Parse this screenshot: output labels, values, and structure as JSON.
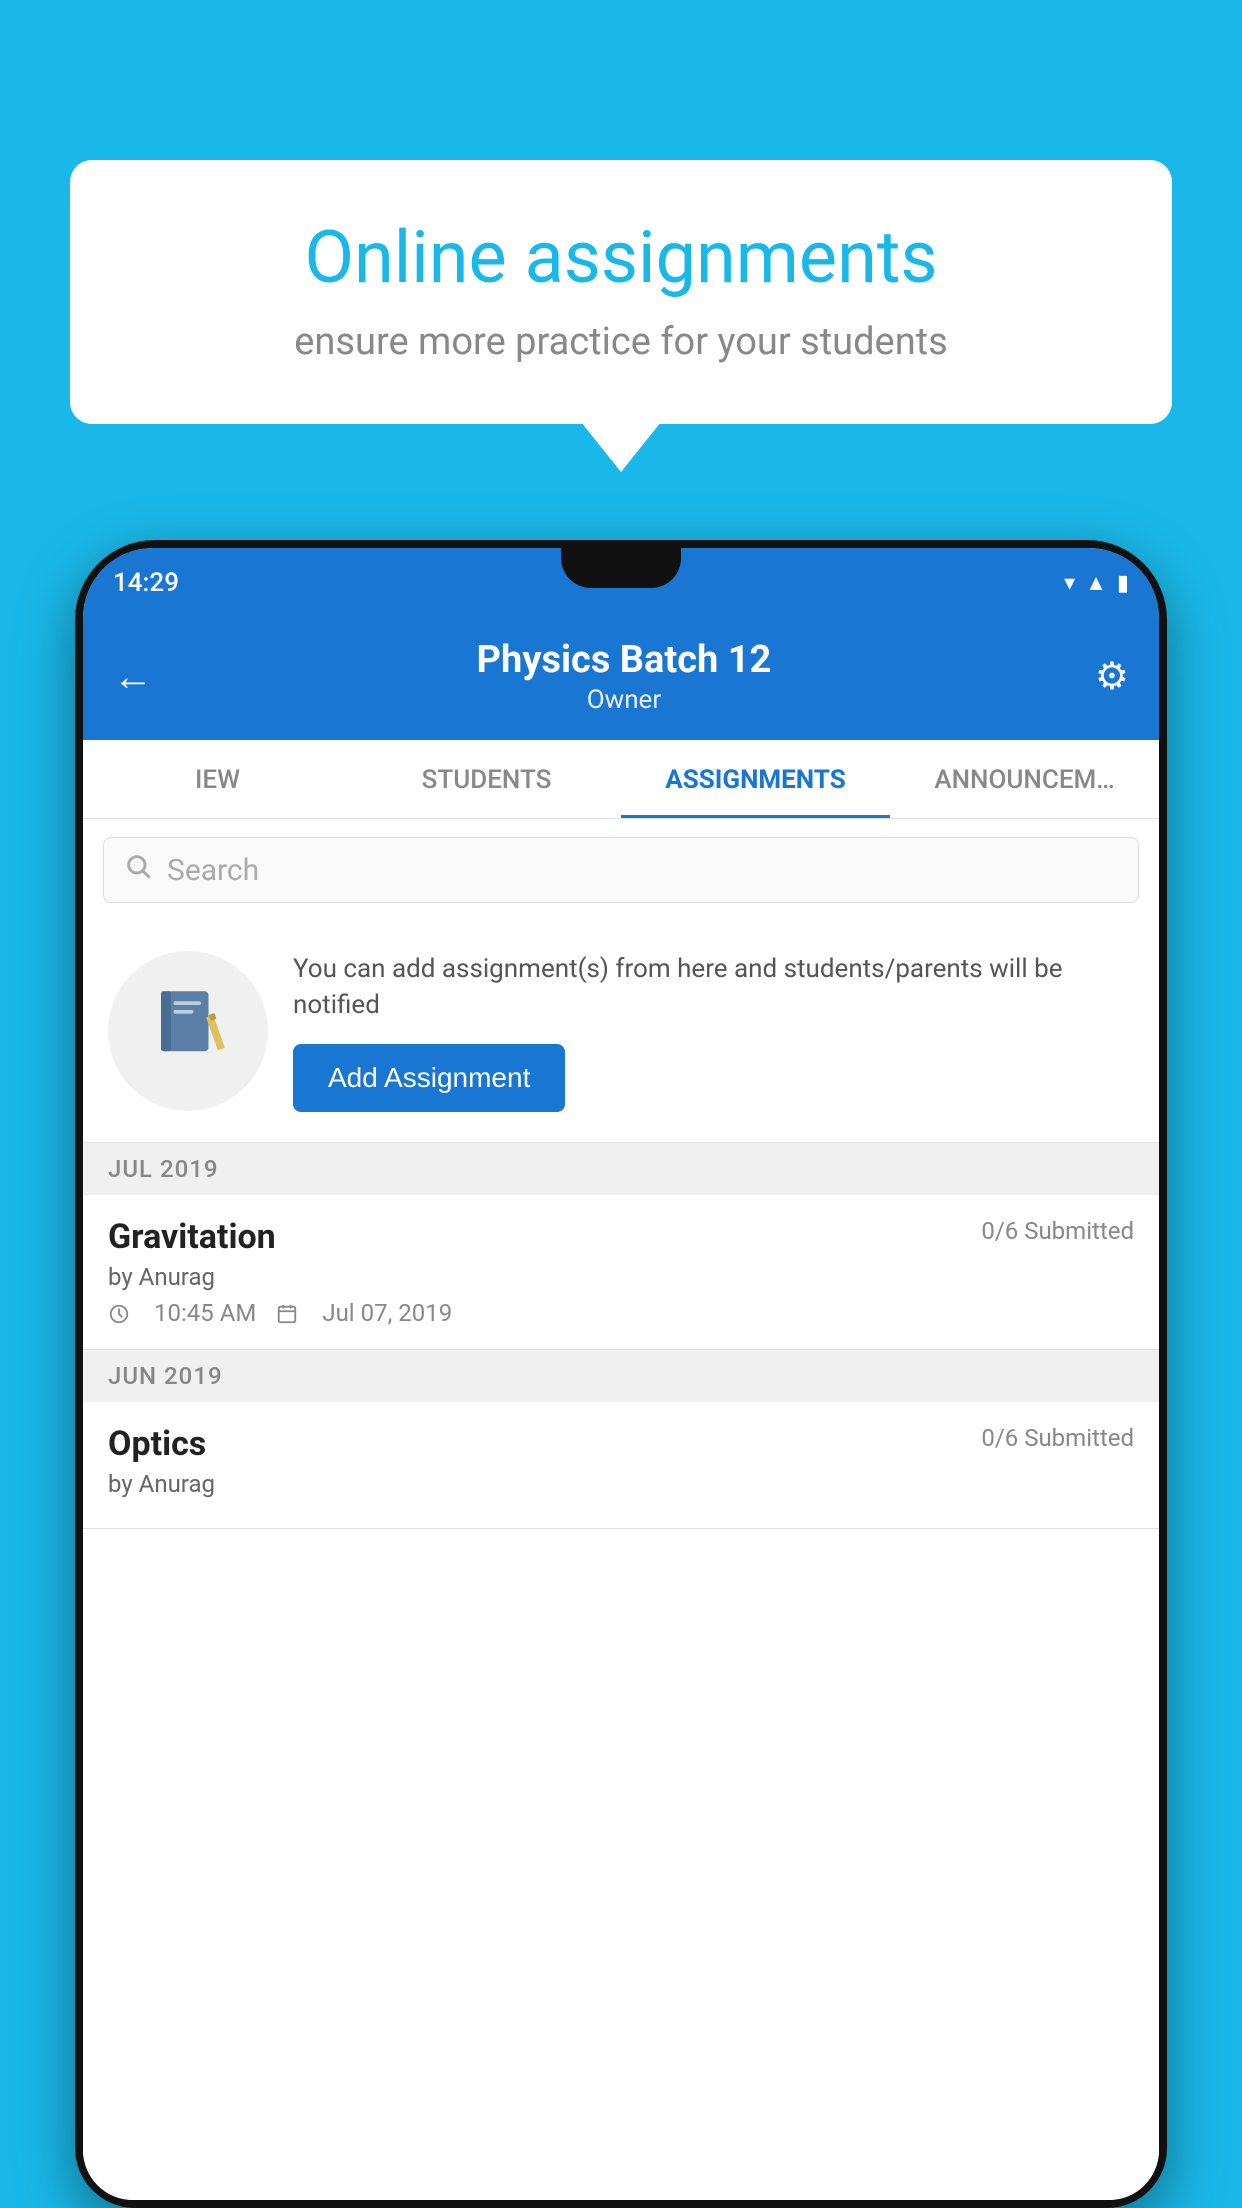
{
  "background_color": "#1ab8e8",
  "speech_bubble": {
    "title": "Online assignments",
    "subtitle": "ensure more practice for your students"
  },
  "phone": {
    "status_bar": {
      "time": "14:29",
      "icons": [
        "wifi",
        "signal",
        "battery"
      ]
    },
    "header": {
      "title": "Physics Batch 12",
      "subtitle": "Owner",
      "back_label": "←",
      "gear_label": "⚙"
    },
    "tabs": [
      {
        "label": "IEW",
        "active": false
      },
      {
        "label": "STUDENTS",
        "active": false
      },
      {
        "label": "ASSIGNMENTS",
        "active": true
      },
      {
        "label": "ANNOUNCEM…",
        "active": false
      }
    ],
    "search": {
      "placeholder": "Search"
    },
    "assignment_prompt": {
      "description": "You can add assignment(s) from here and students/parents will be notified",
      "button_label": "Add Assignment"
    },
    "assignment_groups": [
      {
        "month_label": "JUL 2019",
        "assignments": [
          {
            "title": "Gravitation",
            "submitted": "0/6 Submitted",
            "by": "by Anurag",
            "time": "10:45 AM",
            "date": "Jul 07, 2019"
          }
        ]
      },
      {
        "month_label": "JUN 2019",
        "assignments": [
          {
            "title": "Optics",
            "submitted": "0/6 Submitted",
            "by": "by Anurag",
            "time": "",
            "date": ""
          }
        ]
      }
    ]
  }
}
